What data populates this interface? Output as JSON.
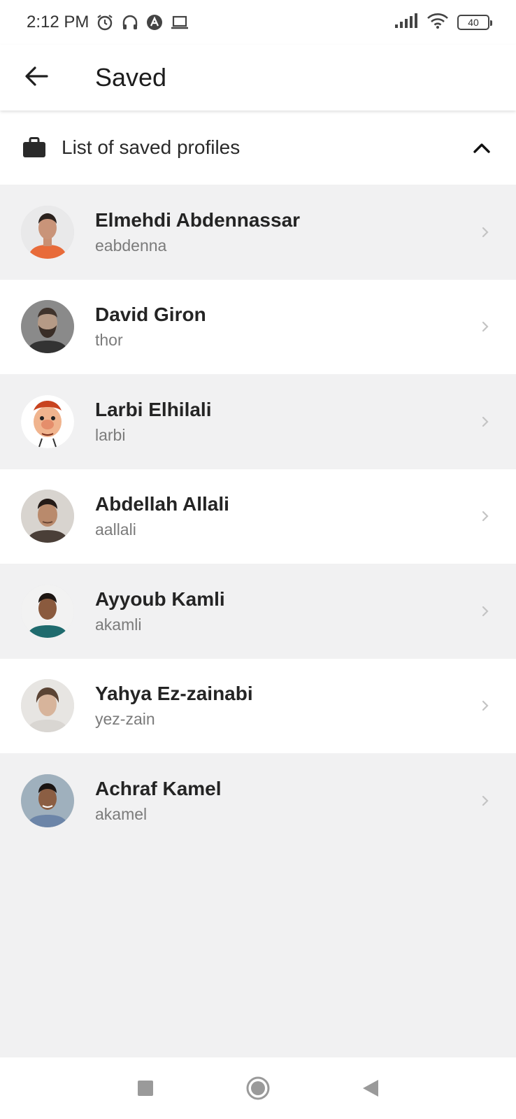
{
  "status_bar": {
    "time": "2:12 PM",
    "icons": [
      "alarm-icon",
      "headphones-icon",
      "app-a-icon",
      "laptop-icon"
    ],
    "right_icons": [
      "signal-icon",
      "wifi-icon"
    ],
    "battery_level": "40"
  },
  "app_bar": {
    "title": "Saved",
    "back_icon": "arrow-left-icon"
  },
  "section": {
    "title": "List of saved profiles",
    "icon": "briefcase-icon",
    "toggle_icon": "chevron-up-icon"
  },
  "profiles": [
    {
      "name": "Elmehdi Abdennassar",
      "login": "eabdenna"
    },
    {
      "name": "David Giron",
      "login": "thor"
    },
    {
      "name": "Larbi Elhilali",
      "login": "larbi"
    },
    {
      "name": "Abdellah Allali",
      "login": "aallali"
    },
    {
      "name": "Ayyoub Kamli",
      "login": "akamli"
    },
    {
      "name": "Yahya Ez-zainabi",
      "login": "yez-zain"
    },
    {
      "name": "Achraf Kamel",
      "login": "akamel"
    }
  ],
  "nav": {
    "buttons": [
      "recents-square-icon",
      "home-circle-icon",
      "back-triangle-icon"
    ]
  },
  "colors": {
    "row_shade": "#f1f1f2",
    "row_light": "#ffffff",
    "text_primary": "#242424",
    "text_secondary": "#7b7b7b"
  }
}
